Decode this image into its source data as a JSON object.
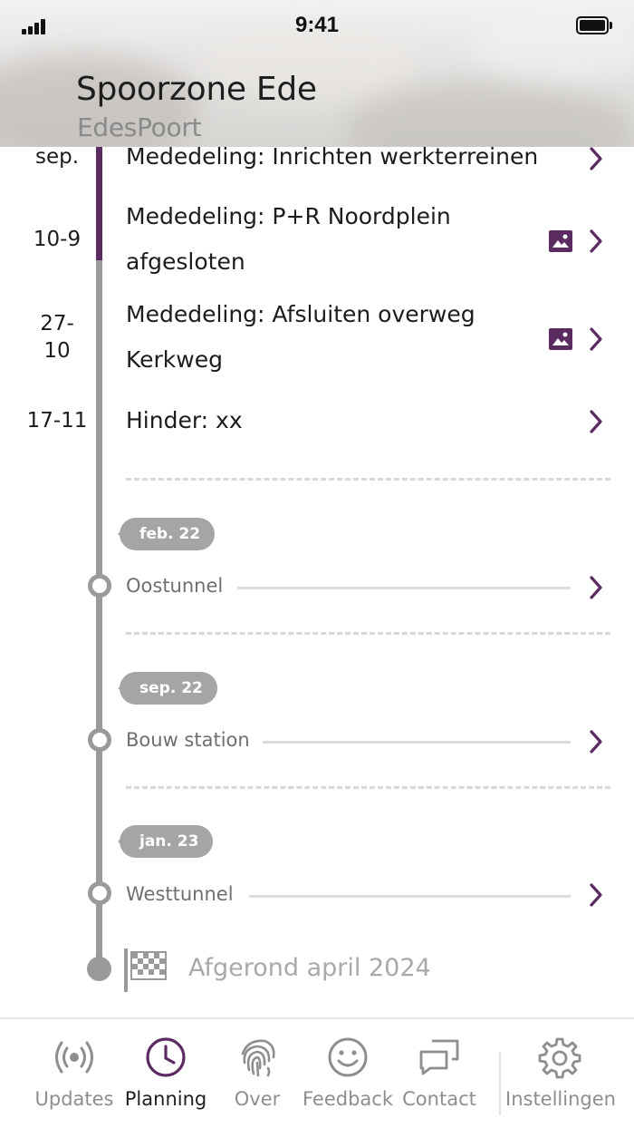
{
  "status": {
    "time": "9:41"
  },
  "header": {
    "title": "Spoorzone Ede",
    "subtitle": "EdesPoort"
  },
  "events": [
    {
      "date": "sep.",
      "title_lines": [
        "Mededeling: Inrichten werkterreinen"
      ],
      "has_image": false
    },
    {
      "date": "10-9",
      "title_lines": [
        "Mededeling: P+R Noordplein",
        "afgesloten"
      ],
      "has_image": true
    },
    {
      "date_lines": [
        "27-",
        "10"
      ],
      "title_lines": [
        "Mededeling: Afsluiten overweg",
        "Kerkweg"
      ],
      "has_image": true
    },
    {
      "date": "17-11",
      "title_lines": [
        "Hinder: xx"
      ],
      "has_image": false
    }
  ],
  "milestones": [
    {
      "badge": "feb. 22",
      "label": "Oostunnel"
    },
    {
      "badge": "sep. 22",
      "label": "Bouw station"
    },
    {
      "badge": "jan. 23",
      "label": "Westtunnel"
    }
  ],
  "finish": {
    "label": "Afgerond april 2024"
  },
  "tabs": [
    {
      "label": "Updates",
      "icon": "broadcast-icon",
      "active": false
    },
    {
      "label": "Planning",
      "icon": "clock-icon",
      "active": true
    },
    {
      "label": "Over",
      "icon": "fingerprint-icon",
      "active": false
    },
    {
      "label": "Feedback",
      "icon": "smiley-icon",
      "active": false
    },
    {
      "label": "Contact",
      "icon": "chat-icon",
      "active": false
    },
    {
      "label": "Instellingen",
      "icon": "gear-icon",
      "active": false
    }
  ],
  "colors": {
    "accent": "#5b2a61",
    "timeline_gray": "#9a9a9a",
    "badge_gray": "#a5a5a5"
  }
}
